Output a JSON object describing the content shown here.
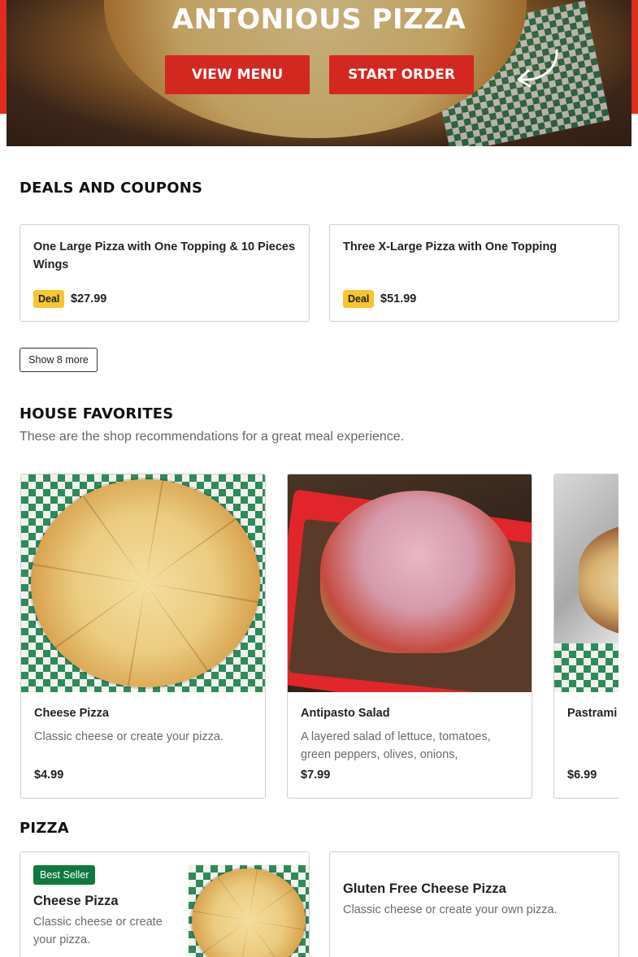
{
  "hero": {
    "title": "ANTONIOUS PIZZA",
    "view_menu_label": "VIEW MENU",
    "start_order_label": "START ORDER",
    "arrow_icon": "curved-arrow-left-icon",
    "accent_color": "#d3281f"
  },
  "deals": {
    "heading": "DEALS AND COUPONS",
    "items": [
      {
        "title": "One Large Pizza with One Topping & 10 Pieces Wings",
        "badge": "Deal",
        "price": "$27.99"
      },
      {
        "title": "Three X-Large Pizza with One Topping",
        "badge": "Deal",
        "price": "$51.99"
      }
    ],
    "show_more_label": "Show 8 more",
    "badge_color": "#f7c531"
  },
  "favorites": {
    "heading": "HOUSE FAVORITES",
    "subheading": "These are the shop recommendations for a great meal experience.",
    "items": [
      {
        "name": "Cheese Pizza",
        "desc_line1": "Classic cheese or create your pizza.",
        "desc_line2": "",
        "price": "$4.99"
      },
      {
        "name": "Antipasto Salad",
        "desc_line1": "A layered salad of lettuce, tomatoes,",
        "desc_line2": "green peppers, olives, onions, pepperoni…",
        "price": "$7.99"
      },
      {
        "name": "Pastrami Sandwich",
        "desc_line1": "",
        "desc_line2": "",
        "price": "$6.99"
      }
    ]
  },
  "pizza": {
    "heading": "PIZZA",
    "items": [
      {
        "badge": "Best Seller",
        "name": "Cheese Pizza",
        "desc_line1": "Classic cheese or create",
        "desc_line2": "your pizza."
      },
      {
        "name": "Gluten Free Cheese Pizza",
        "desc_line1": "Classic cheese or create your own pizza."
      }
    ],
    "badge_color": "#0f7a3d"
  }
}
